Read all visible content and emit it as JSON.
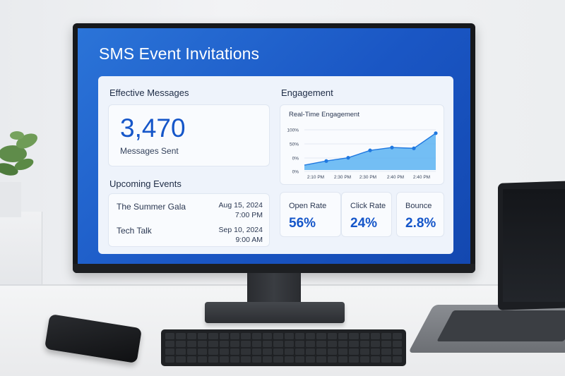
{
  "app": {
    "title": "SMS Event Invitations"
  },
  "effective_messages": {
    "heading": "Effective Messages",
    "count": "3,470",
    "count_label": "Messages Sent"
  },
  "upcoming_events": {
    "heading": "Upcoming Events",
    "events": [
      {
        "name": "The Summer Gala",
        "date": "Aug 15, 2024",
        "time": "7:00 PM"
      },
      {
        "name": "Tech Talk",
        "date": "Sep 10, 2024",
        "time": "9:00 AM"
      }
    ]
  },
  "engagement": {
    "heading": "Engagement",
    "chart_title": "Real-Time Engagement",
    "metrics": [
      {
        "label": "Open Rate",
        "value": "56%"
      },
      {
        "label": "Click Rate",
        "value": "24%"
      },
      {
        "label": "Bounce",
        "value": "2.8%"
      }
    ]
  },
  "chart_data": {
    "type": "area",
    "title": "Real-Time Engagement",
    "y_tick_labels": [
      "100%",
      "50%",
      "0%",
      "0%"
    ],
    "x_tick_labels": [
      "2:10 PM",
      "2:30 PM",
      "2:30 PM",
      "2:40 PM",
      "2:40 PM"
    ],
    "ylim": [
      0,
      100
    ],
    "series": [
      {
        "values": [
          12,
          22,
          30,
          48,
          55,
          53,
          90
        ]
      }
    ],
    "grid": true,
    "colors": {
      "line": "#1f78e0",
      "fill": "#5cb3f2"
    }
  },
  "colors": {
    "accent": "#1556c9",
    "screen_bg": "#1a56c4",
    "panel_bg": "#eef3fb"
  }
}
